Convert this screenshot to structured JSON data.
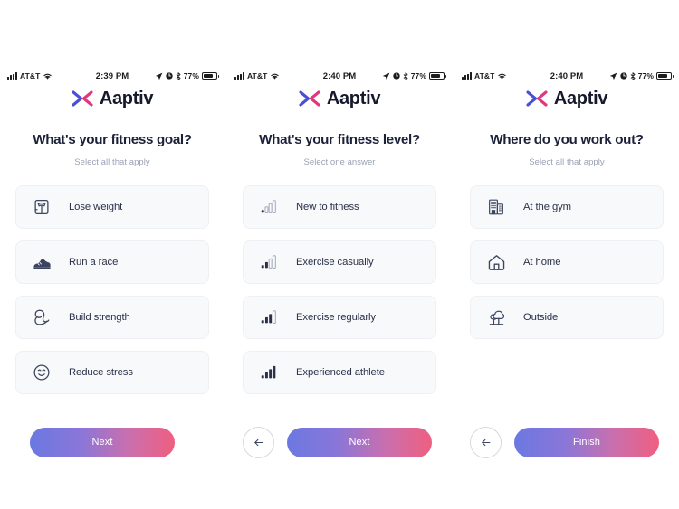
{
  "brand": {
    "name": "Aaptiv",
    "mark_icon": "aaptiv-chevrons-logo",
    "color_left": "#4a4fd4",
    "color_right": "#e0377d"
  },
  "theme": {
    "cta_gradient_start": "#6b78e2",
    "cta_gradient_end": "#ef5f80",
    "card_bg": "#f8f9fb",
    "heading_color": "#1b2138",
    "sub_color": "#9aa1b3"
  },
  "screens": [
    {
      "status": {
        "carrier": "AT&T",
        "time": "2:39 PM",
        "battery_pct": "77%",
        "signal_icon": "signal-bars-icon",
        "wifi_icon": "wifi-icon",
        "location_icon": "location-arrow-icon",
        "alarm_icon": "do-not-disturb-icon",
        "bluetooth_icon": "bluetooth-icon",
        "battery_icon": "battery-icon"
      },
      "heading": "What's your fitness goal?",
      "subheading": "Select all that apply",
      "options": [
        {
          "label": "Lose weight",
          "icon": "scale-icon"
        },
        {
          "label": "Run a race",
          "icon": "running-shoe-icon"
        },
        {
          "label": "Build strength",
          "icon": "flexed-bicep-icon"
        },
        {
          "label": "Reduce stress",
          "icon": "smiley-face-icon"
        }
      ],
      "back_button": {
        "visible": false,
        "icon": "arrow-left-icon"
      },
      "cta": {
        "label": "Next"
      }
    },
    {
      "status": {
        "carrier": "AT&T",
        "time": "2:40 PM",
        "battery_pct": "77%",
        "signal_icon": "signal-bars-icon",
        "wifi_icon": "wifi-icon",
        "location_icon": "location-arrow-icon",
        "alarm_icon": "do-not-disturb-icon",
        "bluetooth_icon": "bluetooth-icon",
        "battery_icon": "battery-icon"
      },
      "heading": "What's your fitness level?",
      "subheading": "Select one answer",
      "options": [
        {
          "label": "New to fitness",
          "icon": "signal-level-1-icon"
        },
        {
          "label": "Exercise casually",
          "icon": "signal-level-2-icon"
        },
        {
          "label": "Exercise regularly",
          "icon": "signal-level-3-icon"
        },
        {
          "label": "Experienced athlete",
          "icon": "signal-level-4-icon"
        }
      ],
      "back_button": {
        "visible": true,
        "icon": "arrow-left-icon"
      },
      "cta": {
        "label": "Next"
      }
    },
    {
      "status": {
        "carrier": "AT&T",
        "time": "2:40 PM",
        "battery_pct": "77%",
        "signal_icon": "signal-bars-icon",
        "wifi_icon": "wifi-icon",
        "location_icon": "location-arrow-icon",
        "alarm_icon": "do-not-disturb-icon",
        "bluetooth_icon": "bluetooth-icon",
        "battery_icon": "battery-icon"
      },
      "heading": "Where do you work out?",
      "subheading": "Select all that apply",
      "options": [
        {
          "label": "At the gym",
          "icon": "building-icon"
        },
        {
          "label": "At home",
          "icon": "house-icon"
        },
        {
          "label": "Outside",
          "icon": "tree-icon"
        }
      ],
      "back_button": {
        "visible": true,
        "icon": "arrow-left-icon"
      },
      "cta": {
        "label": "Finish"
      }
    }
  ]
}
